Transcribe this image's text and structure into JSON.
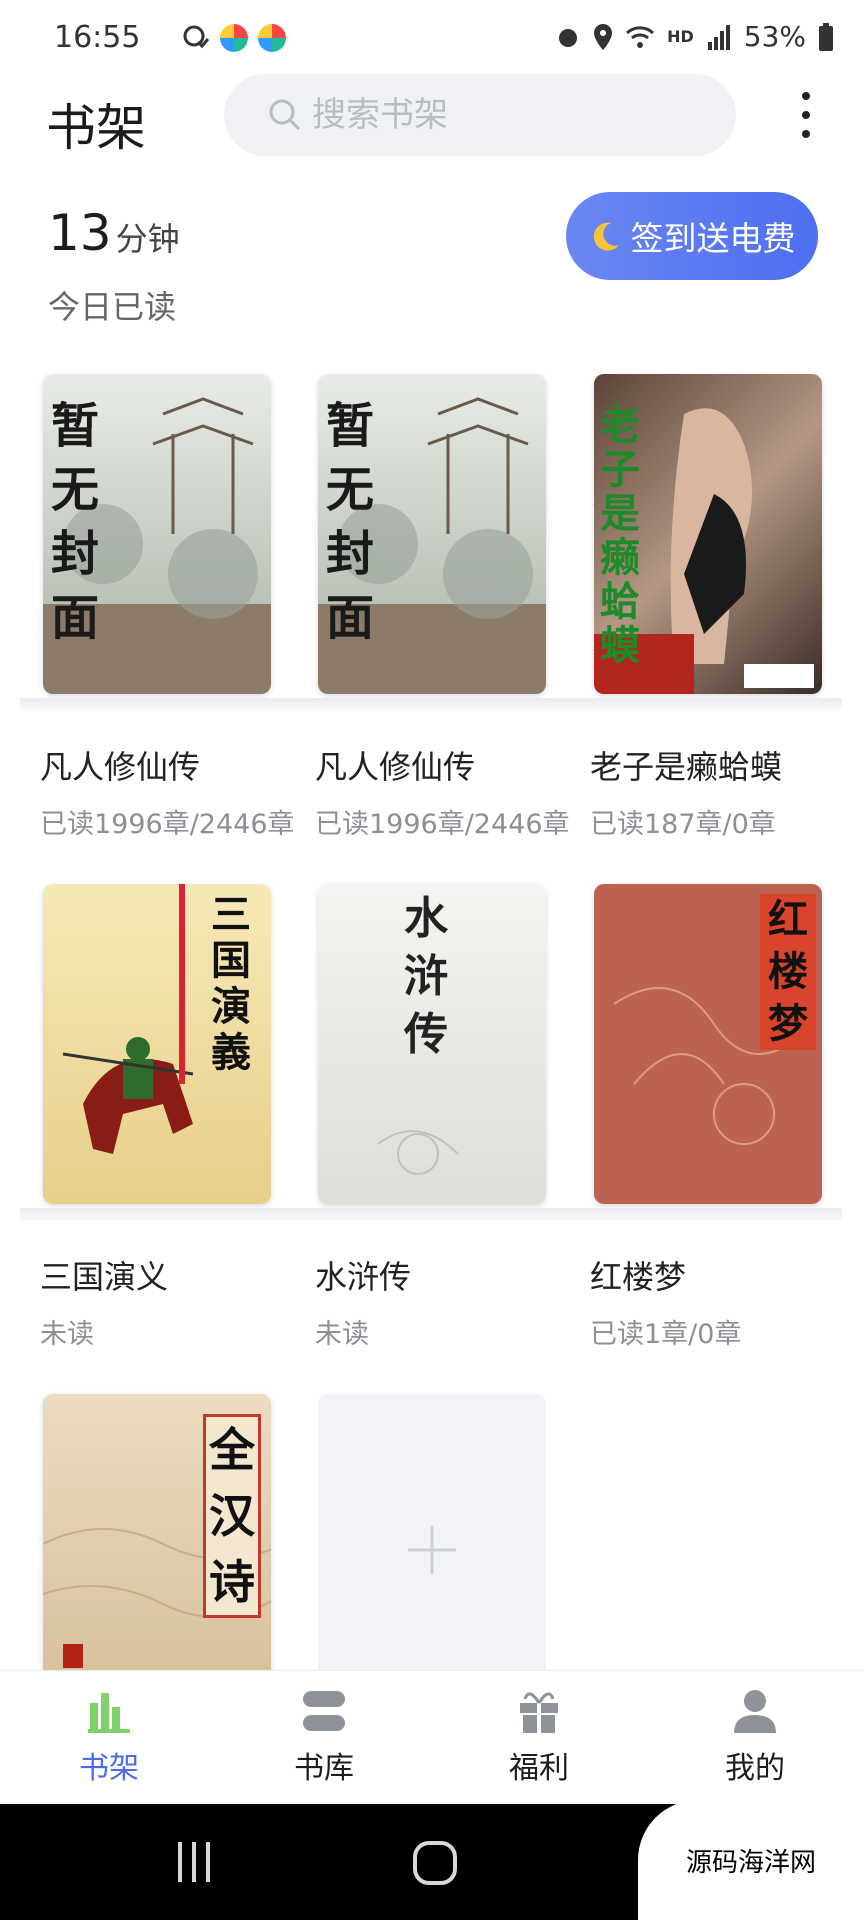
{
  "status_bar": {
    "time": "16:55",
    "battery": "53%",
    "network": "HD"
  },
  "header": {
    "title": "书架",
    "search_placeholder": "搜索书架"
  },
  "stats": {
    "minutes": "13",
    "unit": "分钟",
    "label": "今日已读"
  },
  "signin": {
    "label": "签到送电费"
  },
  "books": [
    {
      "title": "凡人修仙传",
      "progress": "已读1996章/2446章",
      "cover_text": "暂无封面"
    },
    {
      "title": "凡人修仙传",
      "progress": "已读1996章/2446章",
      "cover_text": "暂无封面"
    },
    {
      "title": "老子是癞蛤蟆",
      "progress": "已读187章/0章",
      "cover_text": "老子是癞蛤蟆"
    },
    {
      "title": "三国演义",
      "progress": "未读",
      "cover_text": "三国演義"
    },
    {
      "title": "水浒传",
      "progress": "未读",
      "cover_text": "水浒传"
    },
    {
      "title": "红楼梦",
      "progress": "已读1章/0章",
      "cover_text": "红楼梦"
    },
    {
      "title": "",
      "progress": "",
      "cover_text": "全汉诗"
    }
  ],
  "tabs": [
    {
      "label": "书架",
      "icon": "bookshelf-icon"
    },
    {
      "label": "书库",
      "icon": "library-icon"
    },
    {
      "label": "福利",
      "icon": "gift-icon"
    },
    {
      "label": "我的",
      "icon": "profile-icon"
    }
  ],
  "watermark": "源码海洋网",
  "colors": {
    "accent": "#4a6cf0",
    "background": "#ffffff"
  }
}
